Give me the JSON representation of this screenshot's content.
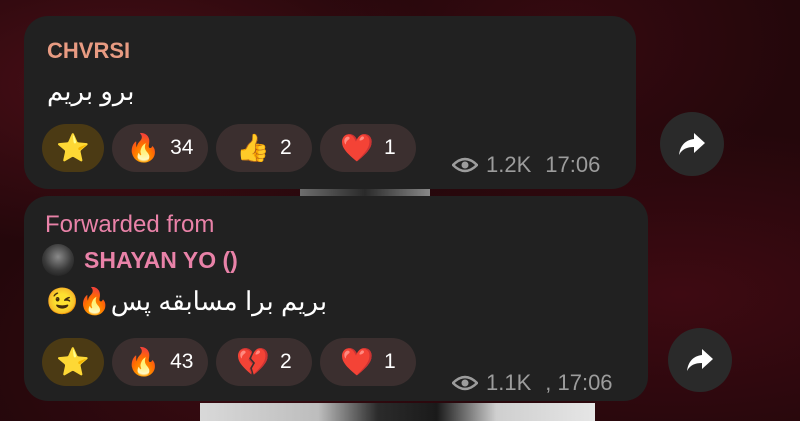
{
  "messages": [
    {
      "sender": "CHVRSI",
      "text": "برو بریم",
      "reactions": [
        {
          "emoji": "⭐",
          "icon": "star-icon",
          "count": ""
        },
        {
          "emoji": "🔥",
          "icon": "fire-icon",
          "count": "34"
        },
        {
          "emoji": "👍",
          "icon": "thumbs-up-icon",
          "count": "2"
        },
        {
          "emoji": "❤️",
          "icon": "heart-icon",
          "count": "1"
        }
      ],
      "views": "1.2K",
      "time": "17:06"
    },
    {
      "forwarded_label": "Forwarded from",
      "forwarded_name": "SHAYAN YO ()",
      "text": "بریم برا مسابقه پس🔥😉",
      "reactions": [
        {
          "emoji": "⭐",
          "icon": "star-icon",
          "count": ""
        },
        {
          "emoji": "🔥",
          "icon": "fire-icon",
          "count": "43"
        },
        {
          "emoji": "💔",
          "icon": "broken-heart-icon",
          "count": "2"
        },
        {
          "emoji": "❤️",
          "icon": "heart-icon",
          "count": "1"
        }
      ],
      "views": "1.1K",
      "time": ", 17:06"
    }
  ],
  "colors": {
    "bubble": "#212121",
    "sender": "#e89b82",
    "forwarded": "#e982a8",
    "meta": "#9c9c9c",
    "reaction_chip": "#3b2f2f",
    "star_chip": "#4b3a14"
  }
}
